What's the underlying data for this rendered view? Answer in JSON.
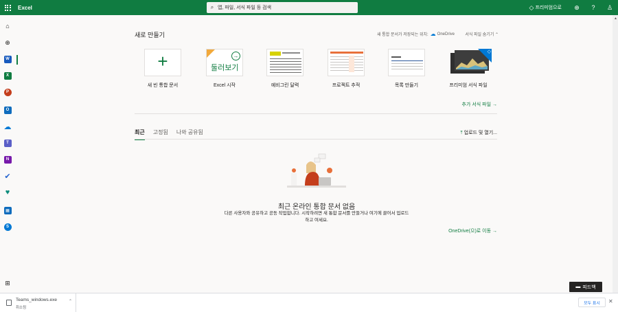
{
  "app": {
    "title": "Excel"
  },
  "search": {
    "placeholder": "앱, 파일, 서식 파일 등 검색"
  },
  "topbar": {
    "premium_label": "프리미엄으로"
  },
  "new_section": {
    "title": "새로 만들기",
    "save_location_text": "새 통합 문서가 저장되는 위치:",
    "save_location_service": "OneDrive",
    "hide_templates": "서식 파일 숨기기",
    "templates": [
      {
        "label": "새 빈 통합 문서"
      },
      {
        "label": "Excel 시작",
        "thumb_text": "둘러보기"
      },
      {
        "label": "예비그린 달력"
      },
      {
        "label": "프로젝트 추적"
      },
      {
        "label": "목록 만들기"
      },
      {
        "label": "프리미엄 서식 파일"
      }
    ],
    "more_templates": "추가 서식 파일"
  },
  "tabs": [
    {
      "label": "최근"
    },
    {
      "label": "고정됨"
    },
    {
      "label": "나와 공유됨"
    }
  ],
  "upload_label": "업로드 및 열기...",
  "empty_state": {
    "title": "최근 온라인 통합 문서 없음",
    "description": "다른 사용자와 공유하고 공동 작업합니다. 시작하려면 새 통합 문서를 만들거나 여기에 끌어서 업로드하고 여세요.",
    "goto_onedrive": "OneDrive(으)로 이동"
  },
  "feedback_label": "피드백",
  "download_bar": {
    "file_name": "Teams_windows.exe",
    "status": "취소됨",
    "show_all": "모두 표시"
  },
  "colors": {
    "excel_green": "#107c41",
    "word_blue": "#185abd",
    "powerpoint_orange": "#c43e1c",
    "outlook_blue": "#0f6cbd",
    "onedrive_blue": "#0078d4",
    "teams_purple": "#5b5fc7",
    "onenote_purple": "#7719aa",
    "todo_blue": "#2564cf",
    "family_teal": "#0c8c7c",
    "skype_blue": "#0078d4"
  },
  "rail": [
    {
      "icon": "home-icon"
    },
    {
      "icon": "create-icon"
    },
    {
      "icon": "word-icon",
      "letter": "W"
    },
    {
      "icon": "excel-icon",
      "letter": "X"
    },
    {
      "icon": "powerpoint-icon",
      "letter": "P"
    },
    {
      "icon": "outlook-icon",
      "letter": "O"
    },
    {
      "icon": "onedrive-icon"
    },
    {
      "icon": "teams-icon",
      "letter": "T"
    },
    {
      "icon": "onenote-icon",
      "letter": "N"
    },
    {
      "icon": "todo-icon"
    },
    {
      "icon": "family-safety-icon"
    },
    {
      "icon": "calendar-icon"
    },
    {
      "icon": "skype-icon",
      "letter": "S"
    },
    {
      "icon": "all-apps-icon"
    }
  ]
}
